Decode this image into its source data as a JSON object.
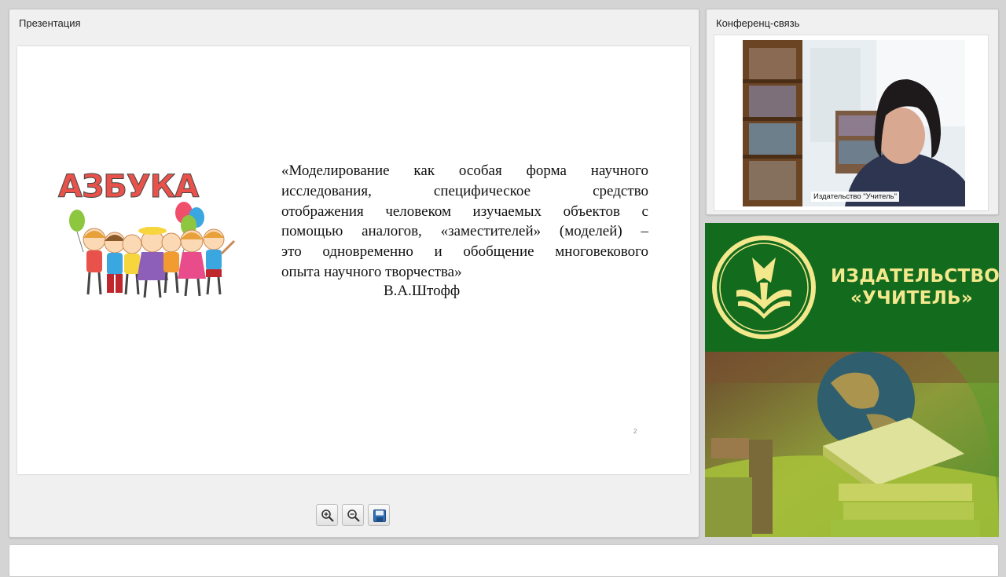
{
  "presentation": {
    "title": "Презентация",
    "slide": {
      "logo_text": "АЗБУКА",
      "quote_lines": [
        "«Моделирование как особая форма научного",
        "исследования, специфическое средство",
        "отображения человеком изучаемых объектов с",
        "помощью аналогов, «заместителей» (моделей) –",
        "это одновременно и обобщение многовекового",
        "опыта научного творчества»"
      ],
      "author": "В.А.Штофф",
      "page_number": "2"
    },
    "toolbar": {
      "icons": [
        "zoom-in-icon",
        "zoom-out-icon",
        "save-icon"
      ]
    }
  },
  "conference": {
    "title": "Конференц-связь",
    "video_label": "Издательство \"Учитель\""
  },
  "banner": {
    "brand_line1": "ИЗДАТЕЛЬСТВО",
    "brand_line2": "«УЧИТЕЛЬ»"
  },
  "colors": {
    "brand_green": "#136b1e",
    "brand_gold": "#f4e88d"
  }
}
